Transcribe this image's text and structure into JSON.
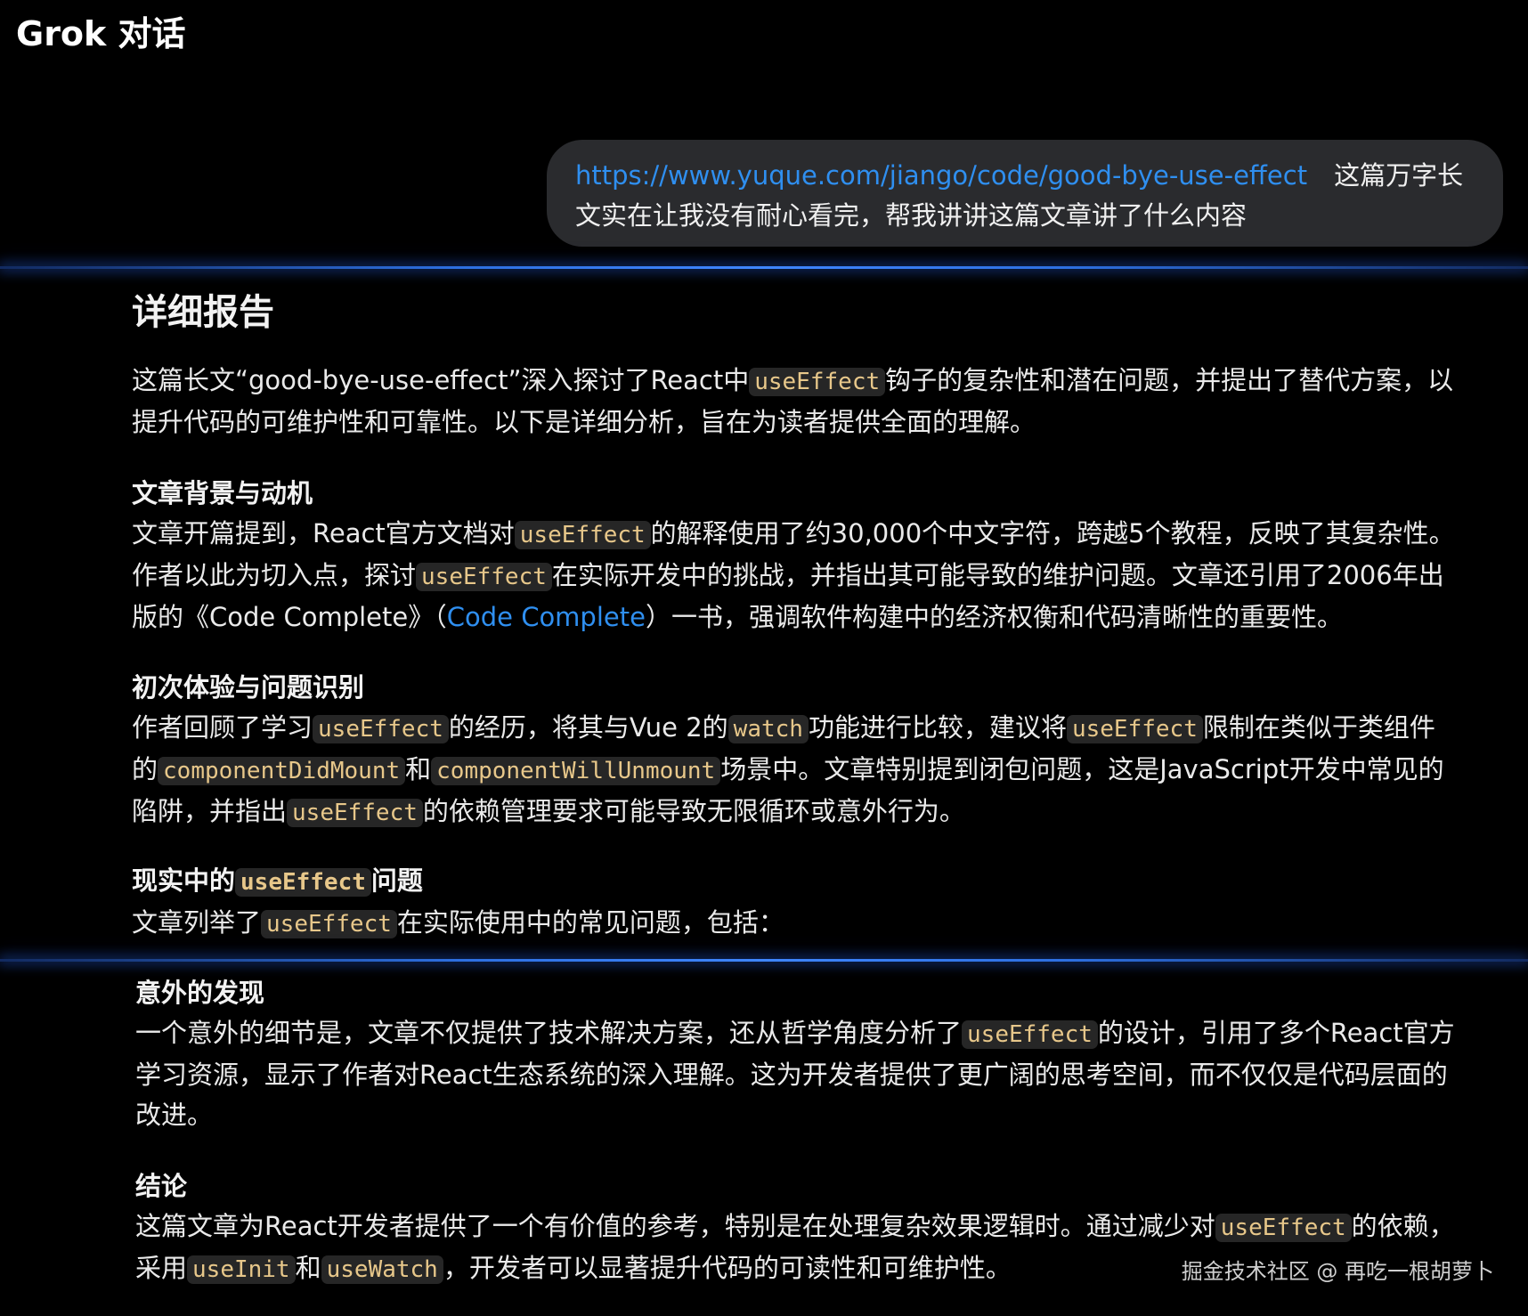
{
  "app_title": "Grok 对话",
  "user_message": {
    "link": "https://www.yuque.com/jiango/code/good-bye-use-effect",
    "text_line1": "这篇万字长",
    "text_line2": "文实在让我没有耐心看完，帮我讲讲这篇文章讲了什么内容"
  },
  "report": {
    "title": "详细报告",
    "intro": {
      "l1_a": "这篇长文“good-bye-use-effect”深入探讨了React中",
      "l1_code": "useEffect",
      "l1_b": "钩子的复杂性和潜在问题，并提出了替代方案，以",
      "l2": "提升代码的可维护性和可靠性。以下是详细分析，旨在为读者提供全面的理解。"
    },
    "background": {
      "title": "文章背景与动机",
      "l1_a": "文章开篇提到，React官方文档对",
      "l1_code": "useEffect",
      "l1_b": "的解释使用了约30,000个中文字符，跨越5个教程，反映了其复杂性。",
      "l2_a": "作者以此为切入点，探讨",
      "l2_code": "useEffect",
      "l2_b": "在实际开发中的挑战，并指出其可能导致的维护问题。文章还引用了2006年出",
      "l3_a": "版的《Code Complete》（",
      "l3_link": "Code Complete",
      "l3_b": "）一书，强调软件构建中的经济权衡和代码清晰性的重要性。"
    },
    "first_experience": {
      "title": "初次体验与问题识别",
      "l1_a": "作者回顾了学习",
      "l1_code1": "useEffect",
      "l1_b": "的经历，将其与Vue 2的",
      "l1_code2": "watch",
      "l1_c": "功能进行比较，建议将",
      "l1_code3": "useEffect",
      "l1_d": "限制在类似于类组件",
      "l2_a": "的",
      "l2_code1": "componentDidMount",
      "l2_b": "和",
      "l2_code2": "componentWillUnmount",
      "l2_c": "场景中。文章特别提到闭包问题，这是JavaScript开发中常见的",
      "l3_a": "陷阱，并指出",
      "l3_code": "useEffect",
      "l3_b": "的依赖管理要求可能导致无限循环或意外行为。"
    },
    "real_problems": {
      "title_a": "现实中的",
      "title_code": "useEffect",
      "title_b": "问题",
      "l1_a": "文章列举了",
      "l1_code": "useEffect",
      "l1_b": "在实际使用中的常见问题，包括："
    },
    "unexpected": {
      "title": "意外的发现",
      "l1_a": "一个意外的细节是，文章不仅提供了技术解决方案，还从哲学角度分析了",
      "l1_code": "useEffect",
      "l1_b": "的设计，引用了多个React官方",
      "l2": "学习资源，显示了作者对React生态系统的深入理解。这为开发者提供了更广阔的思考空间，而不仅仅是代码层面的",
      "l3": "改进。"
    },
    "conclusion": {
      "title": "结论",
      "l1_a": "这篇文章为React开发者提供了一个有价值的参考，特别是在处理复杂效果逻辑时。通过减少对",
      "l1_code": "useEffect",
      "l1_b": "的依赖，",
      "l2_a": "采用",
      "l2_code1": "useInit",
      "l2_b": "和",
      "l2_code2": "useWatch",
      "l2_c": "，开发者可以显著提升代码的可读性和可维护性。"
    }
  },
  "watermark": "掘金技术社区 @ 再吃一根胡萝卜",
  "colors": {
    "background": "#000000",
    "bubble": "#2a2b2e",
    "link": "#2f8ff0",
    "code_text": "#e7c78a",
    "code_bg": "#262626",
    "divider_glow": "#3f86ff"
  }
}
